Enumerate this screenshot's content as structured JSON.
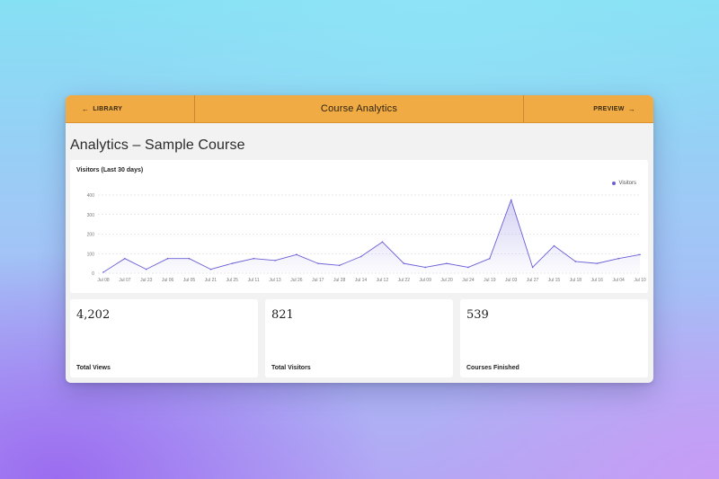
{
  "topbar": {
    "left_label": "LIBRARY",
    "left_icon": "arrow-left-icon",
    "title": "Course Analytics",
    "right_label": "PREVIEW",
    "right_icon": "arrow-right-icon",
    "color": "#f0ab44"
  },
  "page": {
    "heading": "Analytics – Sample Course"
  },
  "chart": {
    "title": "Visitors (Last 30 days)",
    "legend": "Visitors"
  },
  "chart_data": {
    "type": "area",
    "title": "Visitors (Last 30 days)",
    "xlabel": "",
    "ylabel": "",
    "ylim": [
      0,
      400
    ],
    "yticks": [
      0,
      100,
      200,
      300,
      400
    ],
    "grid": true,
    "legend_position": "top-right",
    "categories": [
      "Jul 08",
      "Jul 07",
      "Jul 23",
      "Jul 06",
      "Jul 05",
      "Jul 21",
      "Jul 25",
      "Jul 11",
      "Jul 13",
      "Jul 26",
      "Jul 17",
      "Jul 28",
      "Jul 14",
      "Jul 12",
      "Jul 22",
      "Jul 09",
      "Jul 20",
      "Jul 24",
      "Jul 19",
      "Jul 03",
      "Jul 27",
      "Jul 15",
      "Jul 18",
      "Jul 16",
      "Jul 04",
      "Jul 10"
    ],
    "series": [
      {
        "name": "Visitors",
        "color": "#6a5fd6",
        "values": [
          5,
          75,
          20,
          75,
          75,
          20,
          50,
          75,
          65,
          95,
          50,
          40,
          85,
          160,
          50,
          30,
          50,
          30,
          75,
          375,
          30,
          140,
          60,
          50,
          75,
          95
        ]
      }
    ]
  },
  "stats": [
    {
      "value": "4,202",
      "label": "Total Views"
    },
    {
      "value": "821",
      "label": "Total Visitors"
    },
    {
      "value": "539",
      "label": "Courses Finished"
    }
  ]
}
